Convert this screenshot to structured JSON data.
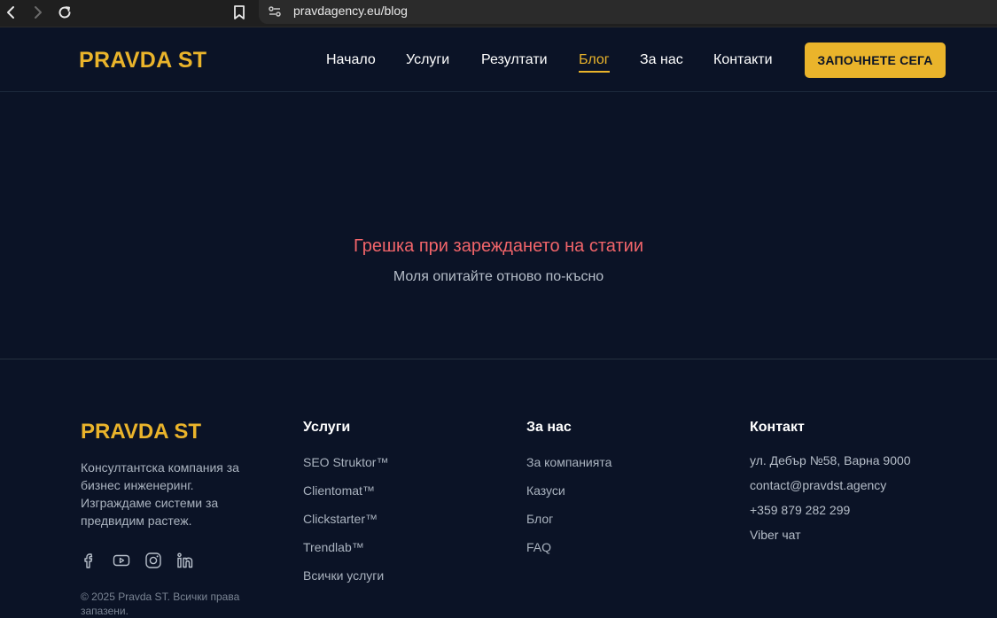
{
  "browser": {
    "url": "pravdagency.eu/blog"
  },
  "header": {
    "logo": "PRAVDA ST",
    "nav": [
      {
        "label": "Начало",
        "active": false
      },
      {
        "label": "Услуги",
        "active": false
      },
      {
        "label": "Резултати",
        "active": false
      },
      {
        "label": "Блог",
        "active": true
      },
      {
        "label": "За нас",
        "active": false
      },
      {
        "label": "Контакти",
        "active": false
      }
    ],
    "cta_label": "ЗАПОЧНЕТЕ СЕГА"
  },
  "main": {
    "error_title": "Грешка при зареждането на статии",
    "error_subtitle": "Моля опитайте отново по-късно"
  },
  "footer": {
    "logo": "PRAVDA ST",
    "description": "Консултантска компания за бизнес инженеринг. Изграждаме системи за предвидим растеж.",
    "social": [
      "facebook-icon",
      "youtube-icon",
      "instagram-icon",
      "linkedin-icon"
    ],
    "copyright": "© 2025 Pravda ST. Всички права запазени.",
    "services": {
      "heading": "Услуги",
      "links": [
        "SEO Struktor™",
        "Clientomat™",
        "Clickstarter™",
        "Trendlab™",
        "Всички услуги"
      ]
    },
    "about": {
      "heading": "За нас",
      "links": [
        "За компанията",
        "Казуси",
        "Блог",
        "FAQ"
      ]
    },
    "contact": {
      "heading": "Контакт",
      "lines": [
        "ул. Дебър №58, Варна 9000",
        "contact@pravdst.agency",
        "+359 879 282 299",
        "Viber чат"
      ]
    }
  },
  "colors": {
    "background": "#0b1326",
    "accent": "#eab42b",
    "error": "#f2656a"
  }
}
